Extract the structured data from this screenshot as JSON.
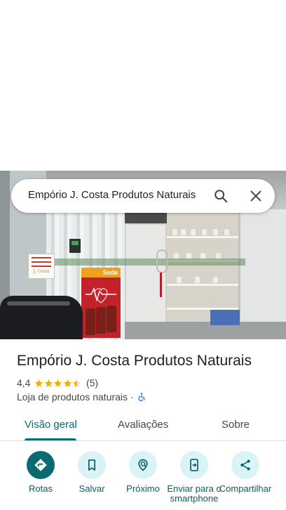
{
  "search": {
    "query": "Empório J. Costa Produtos Naturais"
  },
  "photo": {
    "poster_text": "Sede",
    "sign_text": "J. Costa"
  },
  "place": {
    "title": "Empório J. Costa Produtos Naturais",
    "rating": "4,4",
    "stars": 4.4,
    "review_count": "(5)",
    "category": "Loja de produtos naturais",
    "separator": "·"
  },
  "tabs": [
    {
      "label": "Visão geral",
      "active": true
    },
    {
      "label": "Avaliações",
      "active": false
    },
    {
      "label": "Sobre",
      "active": false
    }
  ],
  "actions": [
    {
      "label": "Rotas",
      "icon": "directions-icon"
    },
    {
      "label": "Salvar",
      "icon": "bookmark-icon"
    },
    {
      "label": "Próximo",
      "icon": "nearby-icon"
    },
    {
      "label": "Enviar para o smartphone",
      "icon": "send-to-phone-icon"
    },
    {
      "label": "Compartilhar",
      "icon": "share-icon"
    }
  ],
  "colors": {
    "accent": "#0b6a6f",
    "action_bg": "#d9f3f7",
    "star": "#f9ab00",
    "accessible": "#1a73e8"
  }
}
